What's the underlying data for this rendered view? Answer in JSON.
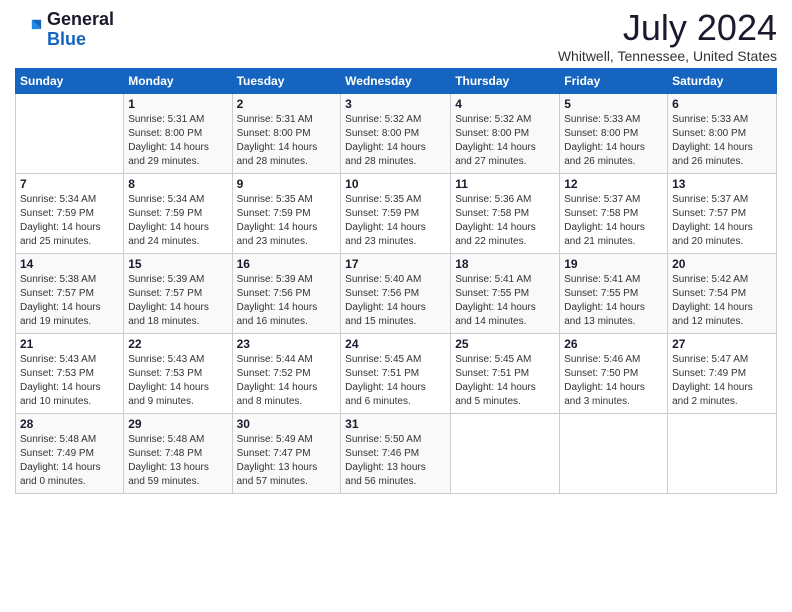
{
  "logo": {
    "general": "General",
    "blue": "Blue"
  },
  "header": {
    "title": "July 2024",
    "subtitle": "Whitwell, Tennessee, United States"
  },
  "weekdays": [
    "Sunday",
    "Monday",
    "Tuesday",
    "Wednesday",
    "Thursday",
    "Friday",
    "Saturday"
  ],
  "weeks": [
    [
      {
        "day": "",
        "info": ""
      },
      {
        "day": "1",
        "info": "Sunrise: 5:31 AM\nSunset: 8:00 PM\nDaylight: 14 hours\nand 29 minutes."
      },
      {
        "day": "2",
        "info": "Sunrise: 5:31 AM\nSunset: 8:00 PM\nDaylight: 14 hours\nand 28 minutes."
      },
      {
        "day": "3",
        "info": "Sunrise: 5:32 AM\nSunset: 8:00 PM\nDaylight: 14 hours\nand 28 minutes."
      },
      {
        "day": "4",
        "info": "Sunrise: 5:32 AM\nSunset: 8:00 PM\nDaylight: 14 hours\nand 27 minutes."
      },
      {
        "day": "5",
        "info": "Sunrise: 5:33 AM\nSunset: 8:00 PM\nDaylight: 14 hours\nand 26 minutes."
      },
      {
        "day": "6",
        "info": "Sunrise: 5:33 AM\nSunset: 8:00 PM\nDaylight: 14 hours\nand 26 minutes."
      }
    ],
    [
      {
        "day": "7",
        "info": "Sunrise: 5:34 AM\nSunset: 7:59 PM\nDaylight: 14 hours\nand 25 minutes."
      },
      {
        "day": "8",
        "info": "Sunrise: 5:34 AM\nSunset: 7:59 PM\nDaylight: 14 hours\nand 24 minutes."
      },
      {
        "day": "9",
        "info": "Sunrise: 5:35 AM\nSunset: 7:59 PM\nDaylight: 14 hours\nand 23 minutes."
      },
      {
        "day": "10",
        "info": "Sunrise: 5:35 AM\nSunset: 7:59 PM\nDaylight: 14 hours\nand 23 minutes."
      },
      {
        "day": "11",
        "info": "Sunrise: 5:36 AM\nSunset: 7:58 PM\nDaylight: 14 hours\nand 22 minutes."
      },
      {
        "day": "12",
        "info": "Sunrise: 5:37 AM\nSunset: 7:58 PM\nDaylight: 14 hours\nand 21 minutes."
      },
      {
        "day": "13",
        "info": "Sunrise: 5:37 AM\nSunset: 7:57 PM\nDaylight: 14 hours\nand 20 minutes."
      }
    ],
    [
      {
        "day": "14",
        "info": "Sunrise: 5:38 AM\nSunset: 7:57 PM\nDaylight: 14 hours\nand 19 minutes."
      },
      {
        "day": "15",
        "info": "Sunrise: 5:39 AM\nSunset: 7:57 PM\nDaylight: 14 hours\nand 18 minutes."
      },
      {
        "day": "16",
        "info": "Sunrise: 5:39 AM\nSunset: 7:56 PM\nDaylight: 14 hours\nand 16 minutes."
      },
      {
        "day": "17",
        "info": "Sunrise: 5:40 AM\nSunset: 7:56 PM\nDaylight: 14 hours\nand 15 minutes."
      },
      {
        "day": "18",
        "info": "Sunrise: 5:41 AM\nSunset: 7:55 PM\nDaylight: 14 hours\nand 14 minutes."
      },
      {
        "day": "19",
        "info": "Sunrise: 5:41 AM\nSunset: 7:55 PM\nDaylight: 14 hours\nand 13 minutes."
      },
      {
        "day": "20",
        "info": "Sunrise: 5:42 AM\nSunset: 7:54 PM\nDaylight: 14 hours\nand 12 minutes."
      }
    ],
    [
      {
        "day": "21",
        "info": "Sunrise: 5:43 AM\nSunset: 7:53 PM\nDaylight: 14 hours\nand 10 minutes."
      },
      {
        "day": "22",
        "info": "Sunrise: 5:43 AM\nSunset: 7:53 PM\nDaylight: 14 hours\nand 9 minutes."
      },
      {
        "day": "23",
        "info": "Sunrise: 5:44 AM\nSunset: 7:52 PM\nDaylight: 14 hours\nand 8 minutes."
      },
      {
        "day": "24",
        "info": "Sunrise: 5:45 AM\nSunset: 7:51 PM\nDaylight: 14 hours\nand 6 minutes."
      },
      {
        "day": "25",
        "info": "Sunrise: 5:45 AM\nSunset: 7:51 PM\nDaylight: 14 hours\nand 5 minutes."
      },
      {
        "day": "26",
        "info": "Sunrise: 5:46 AM\nSunset: 7:50 PM\nDaylight: 14 hours\nand 3 minutes."
      },
      {
        "day": "27",
        "info": "Sunrise: 5:47 AM\nSunset: 7:49 PM\nDaylight: 14 hours\nand 2 minutes."
      }
    ],
    [
      {
        "day": "28",
        "info": "Sunrise: 5:48 AM\nSunset: 7:49 PM\nDaylight: 14 hours\nand 0 minutes."
      },
      {
        "day": "29",
        "info": "Sunrise: 5:48 AM\nSunset: 7:48 PM\nDaylight: 13 hours\nand 59 minutes."
      },
      {
        "day": "30",
        "info": "Sunrise: 5:49 AM\nSunset: 7:47 PM\nDaylight: 13 hours\nand 57 minutes."
      },
      {
        "day": "31",
        "info": "Sunrise: 5:50 AM\nSunset: 7:46 PM\nDaylight: 13 hours\nand 56 minutes."
      },
      {
        "day": "",
        "info": ""
      },
      {
        "day": "",
        "info": ""
      },
      {
        "day": "",
        "info": ""
      }
    ]
  ]
}
